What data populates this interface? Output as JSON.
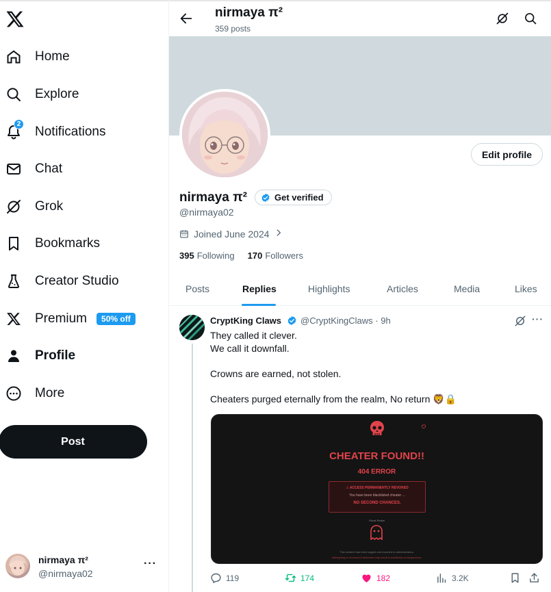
{
  "sidebar": {
    "items": [
      {
        "label": "Home",
        "icon": "home-icon"
      },
      {
        "label": "Explore",
        "icon": "search-icon"
      },
      {
        "label": "Notifications",
        "icon": "bell-icon",
        "badge": "2"
      },
      {
        "label": "Chat",
        "icon": "mail-icon"
      },
      {
        "label": "Grok",
        "icon": "grok-icon"
      },
      {
        "label": "Bookmarks",
        "icon": "bookmark-icon"
      },
      {
        "label": "Creator Studio",
        "icon": "flask-icon"
      },
      {
        "label": "Premium",
        "icon": "x-logo-icon",
        "pill": "50% off"
      },
      {
        "label": "Profile",
        "icon": "person-icon",
        "active": true
      },
      {
        "label": "More",
        "icon": "more-circle-icon"
      }
    ],
    "post_label": "Post",
    "account": {
      "name": "nirmaya π²",
      "handle": "@nirmaya02",
      "more": "···"
    }
  },
  "header": {
    "title": "nirmaya π²",
    "subtitle": "359 posts"
  },
  "profile": {
    "edit_label": "Edit profile",
    "name": "nirmaya π²",
    "verify_label": "Get verified",
    "handle": "@nirmaya02",
    "joined": "Joined June 2024",
    "following_count": "395",
    "following_label": "Following",
    "followers_count": "170",
    "followers_label": "Followers"
  },
  "tabs": [
    {
      "label": "Posts"
    },
    {
      "label": "Replies",
      "active": true
    },
    {
      "label": "Highlights"
    },
    {
      "label": "Articles"
    },
    {
      "label": "Media"
    },
    {
      "label": "Likes"
    }
  ],
  "tweet": {
    "author": "CryptKing Claws",
    "meta": "@CryptKingClaws · 9h",
    "lines": [
      "They called it clever.",
      "We call it downfall.",
      "Crowns are earned, not stolen.",
      "Cheaters purged eternally from the realm, No return 🦁🔒"
    ],
    "media": {
      "title": "CHEATER FOUND!!",
      "subtitle": "404 ERROR",
      "box_a": "⚠ ACCESS PERMANENTLY REVOKED",
      "box_b": "You have been blacklisted cheater ...",
      "box_c": "NO SECOND CHANCES.",
      "small": "Ghost Realm",
      "foot1": "This incident has been logged and reported to administrators.",
      "foot2": "Attempting to circumvent detection may result in additional consequences."
    },
    "actions": {
      "replies": "119",
      "reposts": "174",
      "likes": "182",
      "views": "3.2K"
    }
  },
  "colors": {
    "accent": "#1d9bf0",
    "repost": "#00ba7c",
    "like": "#f91880",
    "media_red": "#e2434a"
  }
}
